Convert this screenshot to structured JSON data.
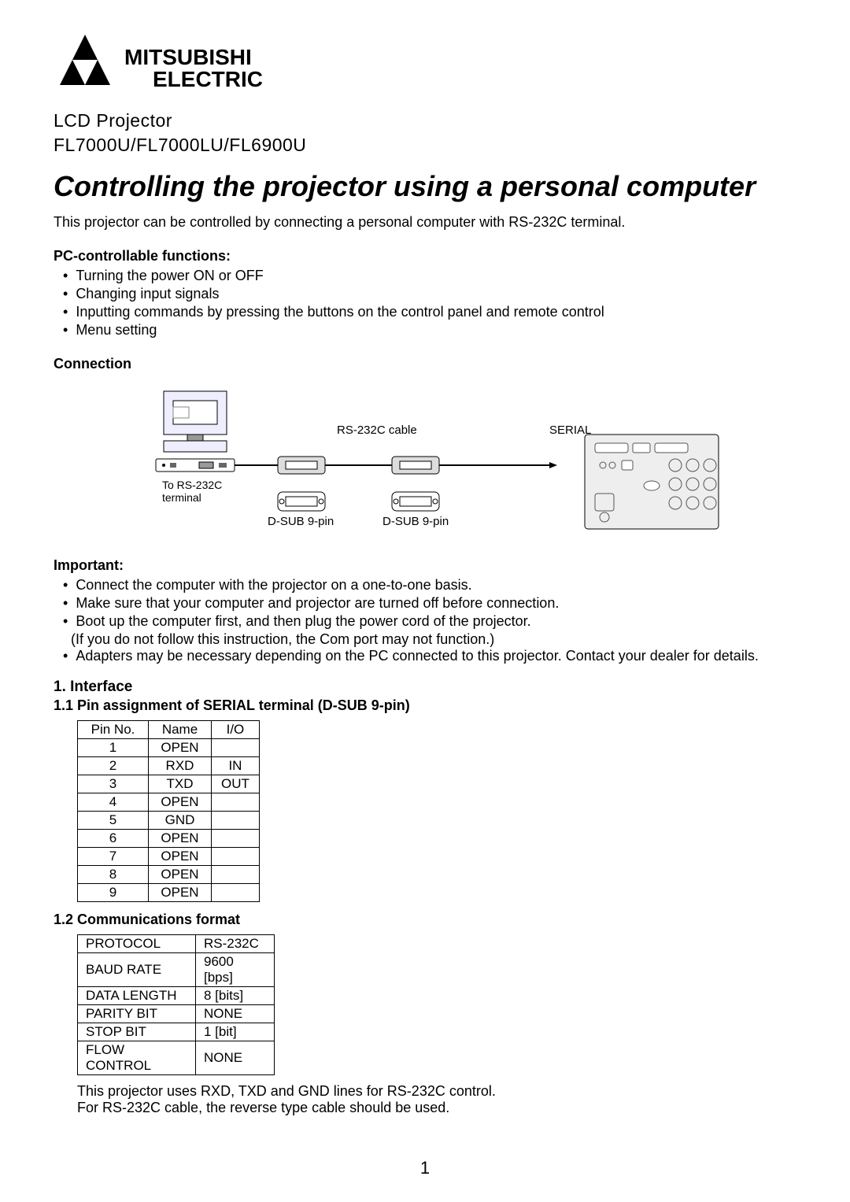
{
  "logo": {
    "brand_top": "MITSUBISHI",
    "brand_bottom": "ELECTRIC"
  },
  "header": {
    "subtitle": "LCD Projector",
    "models": "FL7000U/FL7000LU/FL6900U"
  },
  "title": "Controlling the projector using a personal computer",
  "intro": "This projector can be controlled by connecting a personal computer with RS-232C terminal.",
  "sections": {
    "pc_functions": {
      "heading": "PC-controllable functions:",
      "items": [
        "Turning the power ON or OFF",
        "Changing input signals",
        "Inputting commands by pressing the buttons on the control panel and remote control",
        "Menu setting"
      ]
    },
    "connection": {
      "heading": "Connection",
      "labels": {
        "rs232c_cable": "RS-232C cable",
        "serial": "SERIAL",
        "to_rs232c_terminal_l1": "To RS-232C",
        "to_rs232c_terminal_l2": "terminal",
        "dsub9_left": "D-SUB 9-pin",
        "dsub9_right": "D-SUB 9-pin"
      }
    },
    "important": {
      "heading": "Important:",
      "items": [
        "Connect the computer with the projector on a one-to-one basis.",
        "Make sure that your computer and projector are turned off before connection.",
        "Boot up the computer first, and then plug the power cord of the projector.",
        "Adapters may be necessary depending on the PC connected to this projector. Contact your dealer for details."
      ],
      "subnote": "(If you do not follow this instruction, the Com port may not function.)"
    },
    "interface": {
      "heading": "1.  Interface",
      "sub1": {
        "heading": "1.1  Pin assignment of SERIAL terminal (D-SUB 9-pin)",
        "columns": [
          "Pin No.",
          "Name",
          "I/O"
        ],
        "rows": [
          [
            "1",
            "OPEN",
            ""
          ],
          [
            "2",
            "RXD",
            "IN"
          ],
          [
            "3",
            "TXD",
            "OUT"
          ],
          [
            "4",
            "OPEN",
            ""
          ],
          [
            "5",
            "GND",
            ""
          ],
          [
            "6",
            "OPEN",
            ""
          ],
          [
            "7",
            "OPEN",
            ""
          ],
          [
            "8",
            "OPEN",
            ""
          ],
          [
            "9",
            "OPEN",
            ""
          ]
        ]
      },
      "sub2": {
        "heading": "1.2  Communications format",
        "rows": [
          [
            "PROTOCOL",
            "RS-232C"
          ],
          [
            "BAUD RATE",
            "9600 [bps]"
          ],
          [
            "DATA LENGTH",
            "8 [bits]"
          ],
          [
            "PARITY BIT",
            "NONE"
          ],
          [
            "STOP BIT",
            "1 [bit]"
          ],
          [
            "FLOW CONTROL",
            "NONE"
          ]
        ],
        "note_l1": "This projector uses RXD, TXD and GND lines for RS-232C control.",
        "note_l2": "For RS-232C cable, the reverse type cable should be used."
      }
    }
  },
  "page_number": "1"
}
